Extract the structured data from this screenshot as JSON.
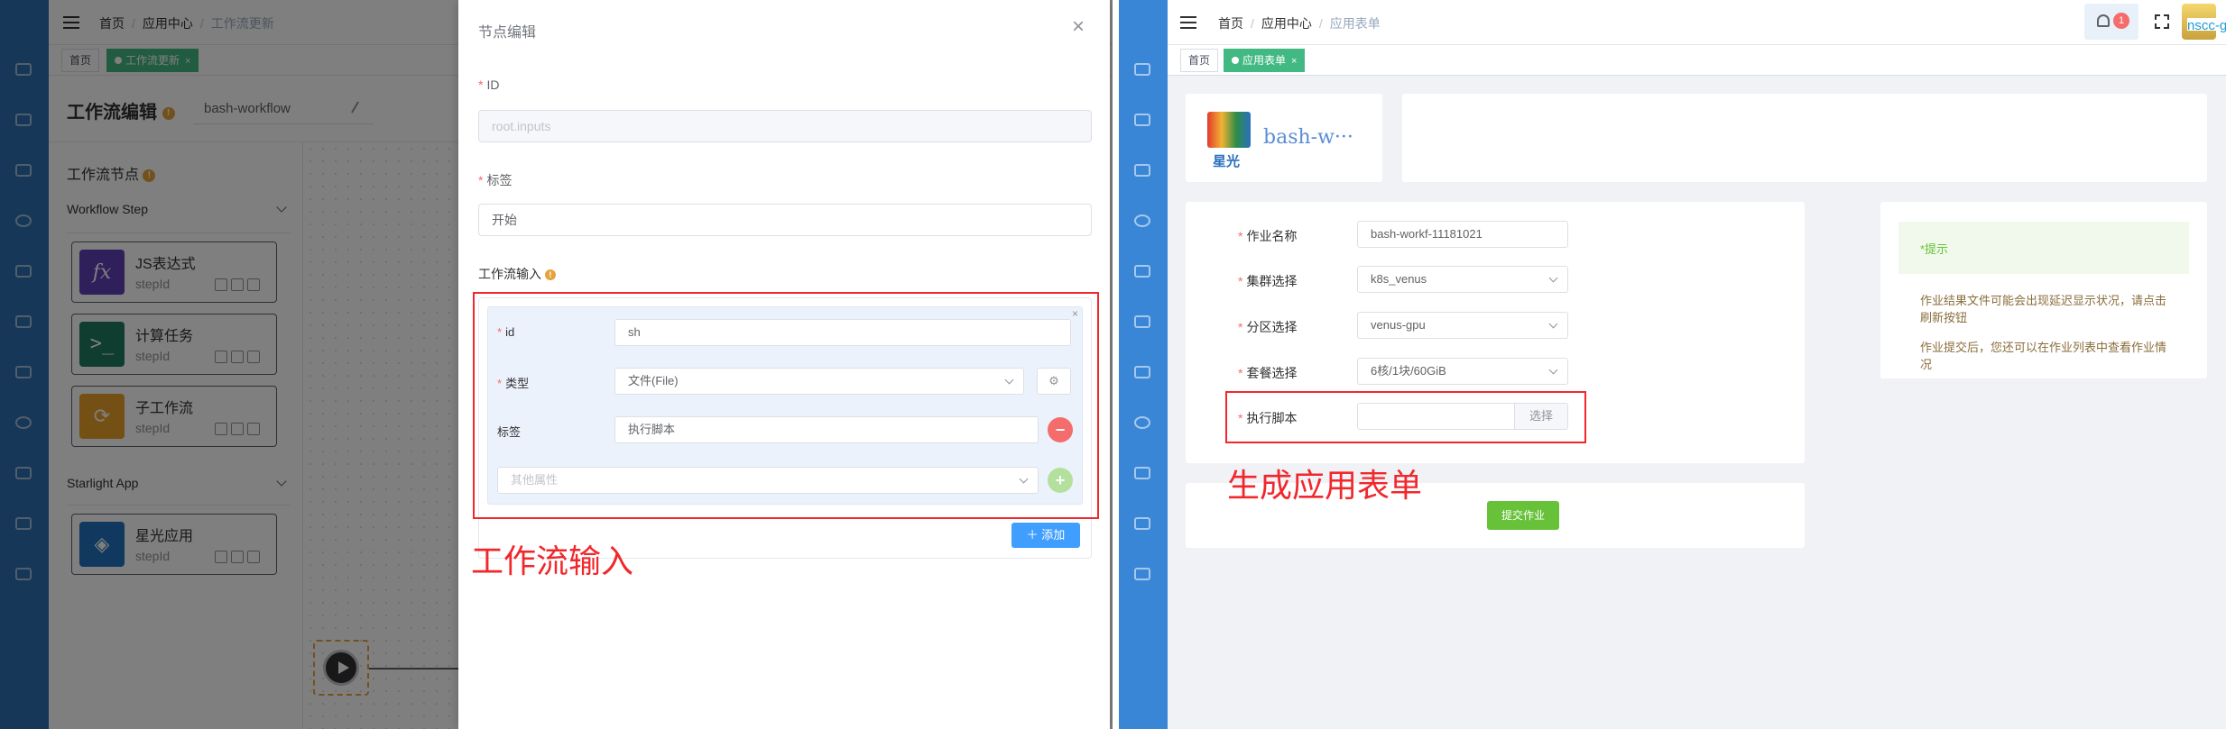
{
  "left": {
    "breadcrumb": [
      "首页",
      "应用中心",
      "工作流更新"
    ],
    "tags": [
      {
        "label": "首页"
      },
      {
        "label": "工作流更新",
        "close": "×"
      }
    ],
    "editor_title": "工作流编辑",
    "workflow_name": "bash-workflow",
    "nodes_title": "工作流节点",
    "groups": [
      {
        "name": "Workflow Step",
        "items": [
          {
            "name": "JS表达式",
            "sub": "stepId",
            "icon": "fx",
            "color": "#6b4cc2"
          },
          {
            "name": "计算任务",
            "sub": "stepId",
            "icon": "terminal",
            "color": "#1f8a70"
          },
          {
            "name": "子工作流",
            "sub": "stepId",
            "icon": "flow",
            "color": "#f0a72e"
          }
        ]
      },
      {
        "name": "Starlight App",
        "items": [
          {
            "name": "星光应用",
            "sub": "stepId",
            "icon": "cube",
            "color": "#2b79c2"
          }
        ]
      }
    ],
    "drawer": {
      "title": "节点编辑",
      "close": "×",
      "id_label": "ID",
      "id_value": "root.inputs",
      "tag_label": "标签",
      "tag_value": "开始",
      "inputs_label": "工作流输入",
      "input_item": {
        "id_label": "id",
        "id_value": "sh",
        "type_label": "类型",
        "type_value": "文件(File)",
        "tag_label": "标签",
        "tag_value": "执行脚本",
        "other_placeholder": "其他属性"
      },
      "add_button": "添加"
    },
    "annotation": "工作流输入"
  },
  "right": {
    "breadcrumb": [
      "首页",
      "应用中心",
      "应用表单"
    ],
    "tags": [
      {
        "label": "首页"
      },
      {
        "label": "应用表单",
        "close": "×"
      }
    ],
    "notif_count": "1",
    "user_name": "nscc-gz...",
    "app_title": "bash-w···",
    "logo_text": "星光",
    "form": {
      "job_name_label": "作业名称",
      "job_name_value": "bash-workf-11181021",
      "cluster_label": "集群选择",
      "cluster_value": "k8s_venus",
      "partition_label": "分区选择",
      "partition_value": "venus-gpu",
      "package_label": "套餐选择",
      "package_value": "6核/1块/60GiB",
      "script_label": "执行脚本",
      "choose_button": "选择",
      "submit_button": "提交作业"
    },
    "tip": {
      "title": "*提示",
      "lines": [
        "作业结果文件可能会出现延迟显示状况，请点击刷新按钮",
        "作业提交后，您还可以在作业列表中查看作业情况"
      ]
    },
    "annotation": "生成应用表单"
  }
}
